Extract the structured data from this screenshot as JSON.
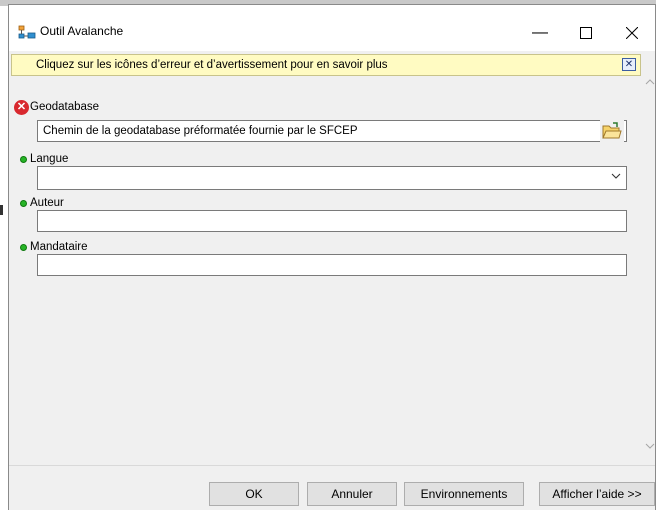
{
  "window": {
    "title": "Outil Avalanche"
  },
  "infobar": {
    "text": "Cliquez sur les icônes d’erreur et d’avertissement pour en savoir plus"
  },
  "params": [
    {
      "label": "Geodatabase",
      "status": "error",
      "value": "Chemin de la geodatabase préformatée fournie par le SFCEP",
      "type": "path"
    },
    {
      "label": "Langue",
      "status": "ok",
      "value": "",
      "type": "select"
    },
    {
      "label": "Auteur",
      "status": "ok",
      "value": "",
      "type": "text"
    },
    {
      "label": "Mandataire",
      "status": "ok",
      "value": "",
      "type": "text"
    }
  ],
  "buttons": {
    "ok": "OK",
    "cancel": "Annuler",
    "environments": "Environnements",
    "help": "Afficher l’aide >>"
  },
  "colors": {
    "infobar_bg": "#fffbc2",
    "error": "#d8282e",
    "ok_dot": "#27b427",
    "window_bg": "#f0f0f0"
  }
}
